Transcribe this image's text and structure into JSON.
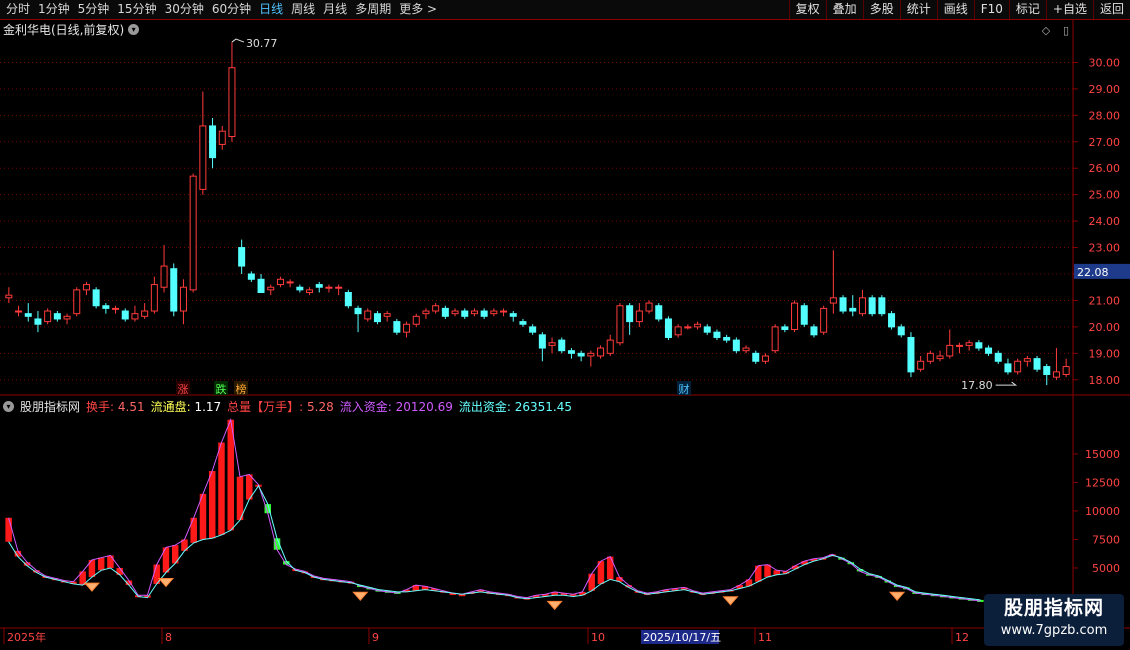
{
  "toolbar": {
    "periods": [
      "分时",
      "1分钟",
      "5分钟",
      "15分钟",
      "30分钟",
      "60分钟",
      "日线",
      "周线",
      "月线",
      "多周期",
      "更多 >"
    ],
    "active_period": "日线",
    "right_buttons": [
      "复权",
      "叠加",
      "多股",
      "统计",
      "画线",
      "F10",
      "标记",
      "+自选",
      "返回"
    ]
  },
  "main_chart": {
    "title": "金利华电(日线,前复权)",
    "high_label": "30.77",
    "low_label": "17.80",
    "current_price": "22.08",
    "y_ticks": [
      "30.00",
      "29.00",
      "28.00",
      "27.00",
      "26.00",
      "25.00",
      "24.00",
      "23.00",
      "22.00",
      "21.00",
      "20.00",
      "19.00",
      "18.00"
    ],
    "event_marks": [
      "涨",
      "跌",
      "榜",
      "财"
    ],
    "colors": {
      "up": "#ff3b3b",
      "down": "#54ffff",
      "grid": "#7a0000",
      "price_box": "#1e3a8a"
    }
  },
  "indicator": {
    "name": "股朋指标网",
    "fields": [
      {
        "label": "换手: ",
        "value": "4.51",
        "color": "#ff4444"
      },
      {
        "label": "流通盘: ",
        "value": "1.17",
        "color": "#ffff55"
      },
      {
        "label": "总量【万手】: ",
        "value": "5.28",
        "color": "#ff4444"
      },
      {
        "label": "流入资金: ",
        "value": "20120.69",
        "color": "#d05cff"
      },
      {
        "label": "流出资金: ",
        "value": "26351.45",
        "color": "#66ffff"
      }
    ],
    "y_ticks": [
      "15000",
      "12500",
      "10000",
      "7500",
      "5000"
    ]
  },
  "x_axis": {
    "labels": [
      "2025年",
      "8",
      "9",
      "10",
      "2025/10/17/五",
      "11",
      "12"
    ]
  },
  "watermark": {
    "line1": "股朋指标网",
    "line2": "www.7gpzb.com"
  },
  "chart_data": [
    {
      "type": "candlestick",
      "title": "金利华电(日线,前复权)",
      "ylim": [
        17.5,
        31
      ],
      "candles": [
        [
          21.1,
          21.2,
          20.9,
          21.5
        ],
        [
          20.6,
          20.6,
          20.4,
          20.8
        ],
        [
          20.5,
          20.4,
          20.2,
          20.9
        ],
        [
          20.3,
          20.1,
          19.8,
          20.6
        ],
        [
          20.2,
          20.6,
          20.1,
          20.7
        ],
        [
          20.5,
          20.3,
          20.2,
          20.6
        ],
        [
          20.3,
          20.4,
          20.1,
          20.5
        ],
        [
          20.5,
          21.4,
          20.4,
          21.5
        ],
        [
          21.4,
          21.6,
          21.2,
          21.7
        ],
        [
          21.4,
          20.8,
          20.7,
          21.5
        ],
        [
          20.8,
          20.7,
          20.5,
          20.9
        ],
        [
          20.7,
          20.7,
          20.5,
          20.8
        ],
        [
          20.6,
          20.3,
          20.2,
          20.7
        ],
        [
          20.3,
          20.5,
          20.2,
          20.8
        ],
        [
          20.4,
          20.6,
          20.3,
          20.9
        ],
        [
          20.6,
          21.6,
          20.5,
          21.9
        ],
        [
          21.5,
          22.3,
          21.3,
          23.1
        ],
        [
          22.2,
          20.6,
          20.4,
          22.4
        ],
        [
          20.6,
          21.5,
          20.1,
          21.8
        ],
        [
          21.4,
          25.7,
          21.3,
          25.8
        ],
        [
          25.2,
          27.6,
          25.0,
          28.9
        ],
        [
          27.6,
          26.4,
          26.0,
          27.9
        ],
        [
          26.9,
          27.4,
          26.7,
          27.6
        ],
        [
          27.2,
          29.8,
          27.0,
          30.77
        ],
        [
          23.0,
          22.3,
          22.0,
          23.3
        ],
        [
          22.0,
          21.8,
          21.7,
          22.1
        ],
        [
          21.8,
          21.3,
          21.3,
          22.0
        ],
        [
          21.4,
          21.5,
          21.2,
          21.6
        ],
        [
          21.6,
          21.8,
          21.5,
          21.9
        ],
        [
          21.7,
          21.7,
          21.5,
          21.8
        ],
        [
          21.5,
          21.4,
          21.3,
          21.6
        ],
        [
          21.3,
          21.4,
          21.2,
          21.5
        ],
        [
          21.6,
          21.5,
          21.3,
          21.7
        ],
        [
          21.5,
          21.5,
          21.3,
          21.6
        ],
        [
          21.5,
          21.5,
          21.2,
          21.6
        ],
        [
          21.3,
          20.8,
          20.7,
          21.4
        ],
        [
          20.7,
          20.5,
          19.8,
          20.8
        ],
        [
          20.3,
          20.6,
          20.2,
          20.7
        ],
        [
          20.5,
          20.2,
          20.1,
          20.6
        ],
        [
          20.4,
          20.5,
          20.2,
          20.6
        ],
        [
          20.2,
          19.8,
          19.7,
          20.3
        ],
        [
          19.8,
          20.1,
          19.6,
          20.2
        ],
        [
          20.1,
          20.4,
          20.0,
          20.5
        ],
        [
          20.5,
          20.6,
          20.3,
          20.7
        ],
        [
          20.6,
          20.8,
          20.5,
          20.9
        ],
        [
          20.7,
          20.4,
          20.3,
          20.8
        ],
        [
          20.5,
          20.6,
          20.4,
          20.7
        ],
        [
          20.6,
          20.4,
          20.3,
          20.7
        ],
        [
          20.5,
          20.6,
          20.4,
          20.7
        ],
        [
          20.6,
          20.4,
          20.3,
          20.7
        ],
        [
          20.5,
          20.6,
          20.4,
          20.7
        ],
        [
          20.6,
          20.6,
          20.4,
          20.7
        ],
        [
          20.5,
          20.4,
          20.2,
          20.6
        ],
        [
          20.2,
          20.1,
          20.0,
          20.3
        ],
        [
          20.0,
          19.8,
          19.7,
          20.1
        ],
        [
          19.7,
          19.2,
          18.7,
          19.8
        ],
        [
          19.3,
          19.4,
          19.0,
          19.6
        ],
        [
          19.5,
          19.1,
          19.0,
          19.6
        ],
        [
          19.1,
          19.0,
          18.8,
          19.2
        ],
        [
          19.0,
          18.9,
          18.7,
          19.1
        ],
        [
          18.9,
          19.0,
          18.5,
          19.1
        ],
        [
          18.9,
          19.2,
          18.8,
          19.3
        ],
        [
          19.0,
          19.5,
          18.9,
          19.7
        ],
        [
          19.4,
          20.8,
          19.3,
          20.9
        ],
        [
          20.8,
          20.2,
          19.7,
          20.9
        ],
        [
          20.2,
          20.6,
          20.0,
          20.9
        ],
        [
          20.6,
          20.9,
          20.5,
          21.0
        ],
        [
          20.8,
          20.3,
          20.2,
          20.9
        ],
        [
          20.3,
          19.6,
          19.5,
          20.4
        ],
        [
          19.7,
          20.0,
          19.6,
          20.1
        ],
        [
          20.0,
          20.0,
          19.9,
          20.1
        ],
        [
          20.0,
          20.1,
          19.9,
          20.2
        ],
        [
          20.0,
          19.8,
          19.7,
          20.1
        ],
        [
          19.8,
          19.6,
          19.5,
          19.9
        ],
        [
          19.6,
          19.5,
          19.4,
          19.7
        ],
        [
          19.5,
          19.1,
          19.0,
          19.6
        ],
        [
          19.1,
          19.2,
          19.0,
          19.3
        ],
        [
          19.0,
          18.7,
          18.6,
          19.1
        ],
        [
          18.7,
          18.9,
          18.6,
          19.0
        ],
        [
          19.1,
          20.0,
          19.0,
          20.1
        ],
        [
          20.0,
          19.9,
          19.8,
          20.1
        ],
        [
          19.9,
          20.9,
          19.8,
          21.0
        ],
        [
          20.8,
          20.1,
          20.0,
          20.9
        ],
        [
          20.0,
          19.7,
          19.6,
          20.1
        ],
        [
          19.8,
          20.7,
          19.7,
          20.8
        ],
        [
          20.9,
          21.1,
          20.5,
          22.9
        ],
        [
          21.1,
          20.6,
          20.5,
          21.2
        ],
        [
          20.7,
          20.6,
          20.4,
          21.2
        ],
        [
          20.5,
          21.1,
          20.4,
          21.4
        ],
        [
          21.1,
          20.5,
          20.4,
          21.2
        ],
        [
          21.1,
          20.5,
          20.4,
          21.2
        ],
        [
          20.5,
          20.0,
          19.9,
          20.6
        ],
        [
          20.0,
          19.7,
          19.6,
          20.1
        ],
        [
          19.6,
          18.3,
          18.1,
          19.8
        ],
        [
          18.4,
          18.7,
          18.3,
          18.9
        ],
        [
          18.7,
          19.0,
          18.6,
          19.1
        ],
        [
          18.8,
          18.9,
          18.7,
          19.1
        ],
        [
          18.9,
          19.3,
          18.8,
          19.9
        ],
        [
          19.3,
          19.3,
          19.0,
          19.4
        ],
        [
          19.3,
          19.4,
          19.1,
          19.5
        ],
        [
          19.4,
          19.2,
          19.1,
          19.5
        ],
        [
          19.2,
          19.0,
          18.9,
          19.3
        ],
        [
          19.0,
          18.7,
          18.6,
          19.1
        ],
        [
          18.6,
          18.3,
          18.2,
          18.8
        ],
        [
          18.3,
          18.7,
          18.2,
          18.8
        ],
        [
          18.7,
          18.8,
          18.5,
          18.9
        ],
        [
          18.8,
          18.4,
          18.3,
          18.9
        ],
        [
          18.5,
          18.2,
          17.8,
          18.6
        ],
        [
          18.1,
          18.3,
          18.0,
          19.2
        ],
        [
          18.2,
          18.5,
          18.1,
          18.8
        ]
      ]
    },
    {
      "type": "bar",
      "title": "股朋指标网",
      "ylim": [
        0,
        18500
      ],
      "inflow": [
        9400,
        6500,
        5500,
        4800,
        4300,
        4100,
        3900,
        3800,
        4700,
        5700,
        5900,
        6100,
        5000,
        3900,
        2600,
        2600,
        5300,
        6800,
        7000,
        7500,
        9400,
        11500,
        13500,
        16000,
        18000,
        13000,
        13200,
        12300,
        9800,
        6600,
        5300,
        4900,
        4700,
        4300,
        4100,
        4000,
        3900,
        3800,
        3400,
        3200,
        3000,
        2900,
        2800,
        3100,
        3500,
        3400,
        3200,
        3000,
        2800,
        2700,
        2900,
        3100,
        2900,
        2800,
        2700,
        2500,
        2400,
        2600,
        2700,
        2900,
        2800,
        2700,
        2900,
        4500,
        5600,
        6000,
        4200,
        3500,
        3000,
        2800,
        2900,
        3100,
        3200,
        3300,
        3000,
        2800,
        2900,
        3000,
        3100,
        3500,
        4000,
        5200,
        5300,
        4800,
        4700,
        5200,
        5600,
        5800,
        5900,
        6200,
        5800,
        5400,
        4700,
        4400,
        4200,
        3800,
        3400,
        3200,
        2800,
        2700,
        2600,
        2500,
        2400,
        2300,
        2200,
        2100
      ],
      "outflow": [
        7300,
        6000,
        5200,
        4600,
        4200,
        4000,
        3800,
        3600,
        3500,
        4200,
        4800,
        5000,
        4400,
        3500,
        2500,
        2400,
        3600,
        4600,
        5400,
        6500,
        7200,
        7500,
        7600,
        7900,
        8300,
        9200,
        11000,
        12200,
        10600,
        7600,
        5600,
        4800,
        4600,
        4200,
        4000,
        3900,
        3800,
        3700,
        3500,
        3300,
        3100,
        3000,
        2900,
        2900,
        3000,
        3100,
        3000,
        2900,
        2800,
        2700,
        2800,
        2900,
        2800,
        2700,
        2600,
        2400,
        2300,
        2400,
        2500,
        2600,
        2600,
        2500,
        2600,
        3000,
        3600,
        4000,
        3800,
        3300,
        2900,
        2700,
        2800,
        2900,
        3000,
        3100,
        2900,
        2700,
        2800,
        2900,
        3000,
        3200,
        3400,
        3800,
        4200,
        4400,
        4500,
        4900,
        5300,
        5600,
        5800,
        6100,
        5900,
        5500,
        4900,
        4500,
        4300,
        3900,
        3500,
        3300,
        2900,
        2800,
        2700,
        2600,
        2500,
        2400,
        2300,
        2200
      ],
      "signals": [
        9,
        17,
        38,
        59,
        78,
        96,
        109,
        124
      ]
    }
  ]
}
